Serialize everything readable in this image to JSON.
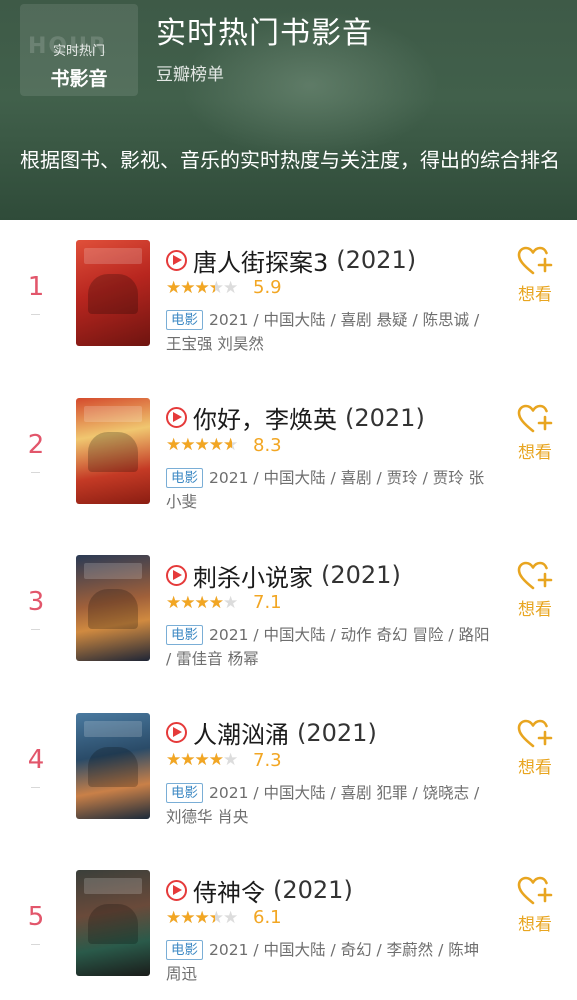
{
  "header": {
    "badge_watermark": "HOUR",
    "badge_line1": "实时热门",
    "badge_line2": "书影音",
    "title": "实时热门书影音",
    "subtitle": "豆瓣榜单",
    "description": "根据图书、影视、音乐的实时热度与关注度，得出的综合排名"
  },
  "colors": {
    "accent_rank": "#e2566b",
    "star": "#f2a623",
    "want": "#e8a520",
    "tag": "#3f8ac4",
    "play": "#e53a3a"
  },
  "items": [
    {
      "rank": "1",
      "name": "唐人街探案3",
      "year": "(2021)",
      "rating_fraction": 0.6,
      "score": "5.9",
      "type_tag": "电影",
      "meta": "2021 / 中国大陆 / 喜剧 悬疑 / 陈思诚 / 王宝强 刘昊然",
      "poster_icon": "poster-image",
      "want_label": "想看"
    },
    {
      "rank": "2",
      "name": "你好，李焕英",
      "year": "(2021)",
      "rating_fraction": 0.8,
      "score": "8.3",
      "type_tag": "电影",
      "meta": "2021 / 中国大陆 / 喜剧 / 贾玲 / 贾玲 张小斐",
      "poster_icon": "poster-image",
      "want_label": "想看"
    },
    {
      "rank": "3",
      "name": "刺杀小说家",
      "year": "(2021)",
      "rating_fraction": 0.7,
      "score": "7.1",
      "type_tag": "电影",
      "meta": "2021 / 中国大陆 / 动作 奇幻 冒险 / 路阳 / 雷佳音 杨幂",
      "poster_icon": "poster-image",
      "want_label": "想看"
    },
    {
      "rank": "4",
      "name": "人潮汹涌",
      "year": "(2021)",
      "rating_fraction": 0.7,
      "score": "7.3",
      "type_tag": "电影",
      "meta": "2021 / 中国大陆 / 喜剧 犯罪 / 饶晓志 / 刘德华 肖央",
      "poster_icon": "poster-image",
      "want_label": "想看"
    },
    {
      "rank": "5",
      "name": "侍神令",
      "year": "(2021)",
      "rating_fraction": 0.6,
      "score": "6.1",
      "type_tag": "电影",
      "meta": "2021 / 中国大陆 / 奇幻 / 李蔚然 / 陈坤 周迅",
      "poster_icon": "poster-image",
      "want_label": "想看"
    }
  ]
}
